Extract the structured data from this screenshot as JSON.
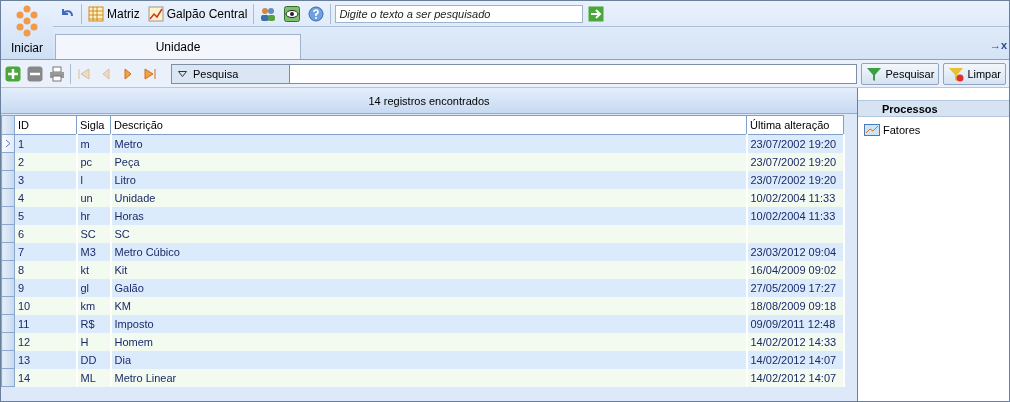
{
  "start_button": {
    "label": "Iniciar"
  },
  "quick_toolbar": [
    {
      "kind": "undo"
    },
    {
      "kind": "sep"
    },
    {
      "kind": "grid",
      "label": "Matriz"
    },
    {
      "kind": "chart",
      "label": "Galpão Central"
    },
    {
      "kind": "sep"
    },
    {
      "kind": "users"
    },
    {
      "kind": "eye"
    },
    {
      "kind": "help"
    },
    {
      "kind": "sep"
    }
  ],
  "search": {
    "placeholder": "Digite o texto a ser pesquisado"
  },
  "tabs": [
    {
      "label": "Unidade",
      "selected": true
    }
  ],
  "tab_close": {
    "label": "→x"
  },
  "record_toolbar": {
    "buttons": [
      {
        "kind": "add",
        "disabled": false
      },
      {
        "kind": "remove",
        "disabled": false
      },
      {
        "kind": "print",
        "disabled": false
      },
      {
        "kind": "first",
        "disabled": true
      },
      {
        "kind": "prev",
        "disabled": true
      },
      {
        "kind": "next",
        "disabled": false
      },
      {
        "kind": "last",
        "disabled": false
      }
    ],
    "filter_label": "Pesquisa",
    "search_button": "Pesquisar",
    "clear_button": "Limpar"
  },
  "record_count": "14 registros encontrados",
  "table": {
    "columns": [
      "ID",
      "Sigla",
      "Descrição",
      "Última alteração"
    ],
    "rows": [
      {
        "cells": [
          "1",
          "m",
          "Metro",
          "23/07/2002 19:20"
        ],
        "selected": true
      },
      {
        "cells": [
          "2",
          "pc",
          "Peça",
          "23/07/2002 19:20"
        ],
        "selected": false
      },
      {
        "cells": [
          "3",
          "l",
          "Litro",
          "23/07/2002 19:20"
        ],
        "selected": false
      },
      {
        "cells": [
          "4",
          "un",
          "Unidade",
          "10/02/2004 11:33"
        ],
        "selected": false
      },
      {
        "cells": [
          "5",
          "hr",
          "Horas",
          "10/02/2004 11:33"
        ],
        "selected": false
      },
      {
        "cells": [
          "6",
          "SC",
          "SC",
          ""
        ],
        "selected": false
      },
      {
        "cells": [
          "7",
          "M3",
          "Metro Cúbico",
          "23/03/2012 09:04"
        ],
        "selected": false
      },
      {
        "cells": [
          "8",
          "kt",
          "Kit",
          "16/04/2009 09:02"
        ],
        "selected": false
      },
      {
        "cells": [
          "9",
          "gl",
          "Galão",
          "27/05/2009 17:27"
        ],
        "selected": false
      },
      {
        "cells": [
          "10",
          "km",
          "KM",
          "18/08/2009 09:18"
        ],
        "selected": false
      },
      {
        "cells": [
          "11",
          "R$",
          "Imposto",
          "09/09/2011 12:48"
        ],
        "selected": false
      },
      {
        "cells": [
          "12",
          "H",
          "Homem",
          "14/02/2012 14:33"
        ],
        "selected": false
      },
      {
        "cells": [
          "13",
          "DD",
          "Dia",
          "14/02/2012 14:07"
        ],
        "selected": false
      },
      {
        "cells": [
          "14",
          "ML",
          "Metro Linear",
          "14/02/2012 14:07"
        ],
        "selected": false
      }
    ]
  },
  "side_panel": {
    "title": "Processos",
    "items": [
      {
        "label": "Fatores"
      }
    ]
  }
}
